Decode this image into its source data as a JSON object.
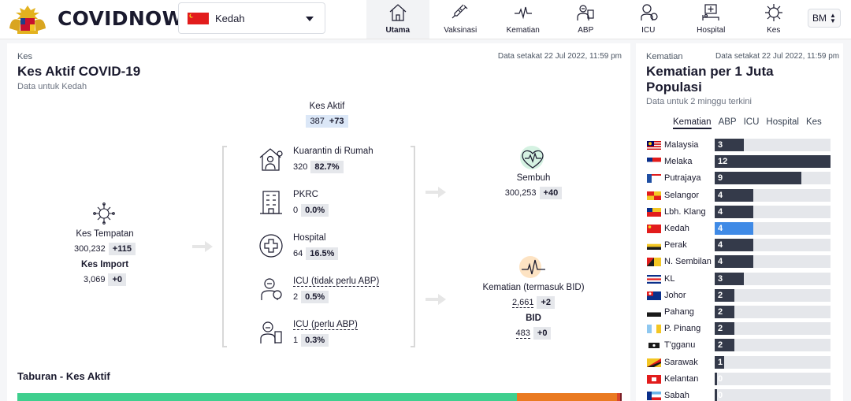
{
  "header": {
    "brand": "COVIDNOW",
    "state_select": {
      "value": "Kedah"
    },
    "nav": [
      {
        "id": "utama",
        "label": "Utama",
        "icon": "home-icon",
        "active": true
      },
      {
        "id": "vaksinasi",
        "label": "Vaksinasi",
        "icon": "syringe-icon",
        "active": false
      },
      {
        "id": "kematian",
        "label": "Kematian",
        "icon": "heartbeat-icon",
        "active": false
      },
      {
        "id": "abp",
        "label": "ABP",
        "icon": "ventilator-doctor-icon",
        "active": false
      },
      {
        "id": "icu",
        "label": "ICU",
        "icon": "icu-doctor-icon",
        "active": false
      },
      {
        "id": "hospital",
        "label": "Hospital",
        "icon": "hospital-bed-icon",
        "active": false
      },
      {
        "id": "kes",
        "label": "Kes",
        "icon": "virus-icon",
        "active": false
      }
    ],
    "language": "BM"
  },
  "active_cases": {
    "eyebrow": "Kes",
    "updated": "Data setakat 22 Jul 2022, 11:59 pm",
    "title": "Kes Aktif COVID-19",
    "subtitle": "Data untuk Kedah",
    "top": {
      "label": "Kes Aktif",
      "value": "387",
      "delta": "+73"
    },
    "local": {
      "label": "Kes Tempatan",
      "value": "300,232",
      "delta": "+115"
    },
    "import": {
      "label": "Kes Import",
      "value": "3,069",
      "delta": "+0"
    },
    "breakdown": [
      {
        "label": "Kuarantin di Rumah",
        "value": "320",
        "pct": "82.7%",
        "icon": "home-quarantine-icon"
      },
      {
        "label": "PKRC",
        "value": "0",
        "pct": "0.0%",
        "icon": "building-icon"
      },
      {
        "label": "Hospital",
        "value": "64",
        "pct": "16.5%",
        "icon": "medical-cross-icon"
      },
      {
        "label": "ICU (tidak perlu ABP)",
        "value": "2",
        "pct": "0.5%",
        "icon": "icu-doctor-icon"
      },
      {
        "label": "ICU (perlu ABP)",
        "value": "1",
        "pct": "0.3%",
        "icon": "ventilator-doctor-icon"
      }
    ],
    "recovered": {
      "label": "Sembuh",
      "value": "300,253",
      "delta": "+40"
    },
    "deaths": {
      "label": "Kematian (termasuk BID)",
      "value": "2,661",
      "delta": "+2"
    },
    "bid": {
      "label": "BID",
      "value": "483",
      "delta": "+0"
    },
    "distribution_title": "Taburan - Kes Aktif",
    "distribution": [
      {
        "name": "Kuarantin di Rumah",
        "pct": 82.7,
        "color": "#3fcf8e"
      },
      {
        "name": "PKRC",
        "pct": 0.0,
        "color": "#a3a3a3"
      },
      {
        "name": "Hospital",
        "pct": 16.5,
        "color": "#ea7a21"
      },
      {
        "name": "ICU (tidak perlu ABP)",
        "pct": 0.5,
        "color": "#d9462b"
      },
      {
        "name": "ICU (perlu ABP)",
        "pct": 0.3,
        "color": "#7b1e27"
      }
    ]
  },
  "deaths_per_million": {
    "eyebrow": "Kematian",
    "updated": "Data setakat 22 Jul 2022, 11:59 pm",
    "title_line1": "Kematian per 1 Juta",
    "title_line2": "Populasi",
    "subtitle": "Data untuk 2 minggu terkini",
    "tabs": [
      {
        "label": "Kematian",
        "active": true
      },
      {
        "label": "ABP",
        "active": false
      },
      {
        "label": "ICU",
        "active": false
      },
      {
        "label": "Hospital",
        "active": false
      },
      {
        "label": "Kes",
        "active": false
      }
    ],
    "max": 12,
    "rows": [
      {
        "name": "Malaysia",
        "value": 3,
        "highlight": false
      },
      {
        "name": "Melaka",
        "value": 12,
        "highlight": false
      },
      {
        "name": "Putrajaya",
        "value": 9,
        "highlight": false
      },
      {
        "name": "Selangor",
        "value": 4,
        "highlight": false
      },
      {
        "name": "Lbh. Klang",
        "value": 4,
        "highlight": false
      },
      {
        "name": "Kedah",
        "value": 4,
        "highlight": true
      },
      {
        "name": "Perak",
        "value": 4,
        "highlight": false
      },
      {
        "name": "N. Sembilan",
        "value": 4,
        "highlight": false
      },
      {
        "name": "KL",
        "value": 3,
        "highlight": false
      },
      {
        "name": "Johor",
        "value": 2,
        "highlight": false
      },
      {
        "name": "Pahang",
        "value": 2,
        "highlight": false
      },
      {
        "name": "P. Pinang",
        "value": 2,
        "highlight": false
      },
      {
        "name": "T'gganu",
        "value": 2,
        "highlight": false
      },
      {
        "name": "Sarawak",
        "value": 1,
        "highlight": false
      },
      {
        "name": "Kelantan",
        "value": 0,
        "highlight": false
      },
      {
        "name": "Sabah",
        "value": 0,
        "highlight": false
      }
    ]
  }
}
